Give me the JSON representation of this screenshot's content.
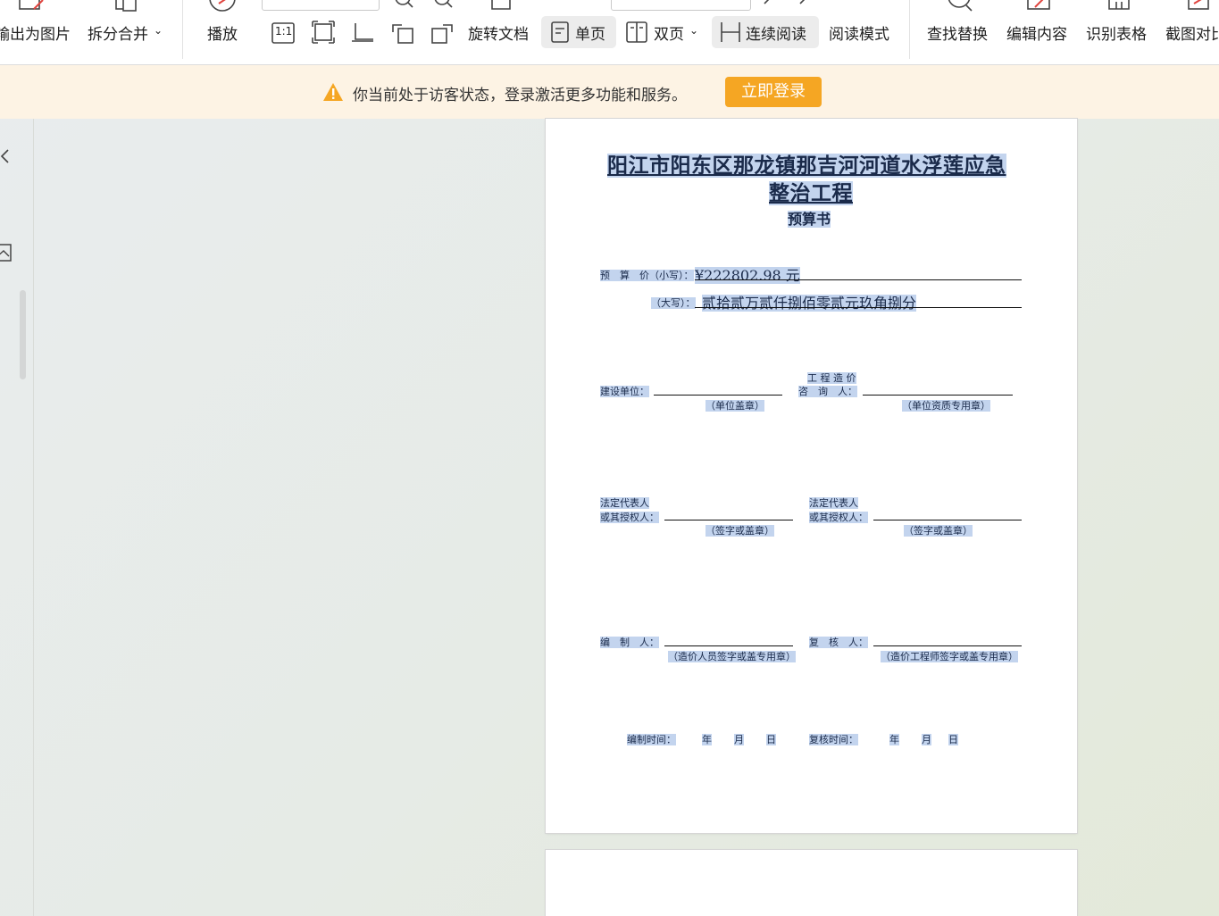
{
  "toolbar": {
    "items": [
      {
        "label": "输出为图片"
      },
      {
        "label": "拆分合并"
      },
      {
        "label": "播放"
      },
      {
        "label": "旋转文档"
      },
      {
        "label": "单页"
      },
      {
        "label": "双页"
      },
      {
        "label": "连续阅读"
      },
      {
        "label": "阅读模式"
      },
      {
        "label": "查找替换"
      },
      {
        "label": "编辑内容"
      },
      {
        "label": "识别表格"
      },
      {
        "label": "截图对比"
      }
    ],
    "ratio_label": "1:1"
  },
  "banner": {
    "message": "你当前处于访客状态，登录激活更多功能和服务。",
    "login_label": "立即登录",
    "accent": "#f5a623"
  },
  "document": {
    "title_line1": "阳江市阳东区那龙镇那吉河河道水浮莲应急",
    "title_line2": "整治工程",
    "subtitle": "预算书",
    "price_small_label": "预　算　价（小写）：",
    "price_small_value": "¥222802.98 元",
    "price_big_label": "（大写）：",
    "price_big_value": "贰拾贰万贰仟捌佰零贰元玖角捌分",
    "build_unit_label": "建设单位：",
    "build_unit_note": "（单位盖章）",
    "consult_label_top": "工 程 造 价",
    "consult_label_bottom": "咨　询　人：",
    "consult_note": "（单位资质专用章）",
    "legal_rep_line1": "法定代表人",
    "legal_rep_line2": "或其授权人：",
    "legal_rep_note": "（签字或盖章）",
    "compiler_label": "编　制　人：",
    "compiler_note": "（造价人员签字或盖专用章）",
    "reviewer_label": "复　核　人：",
    "reviewer_note": "（造价工程师签字或盖专用章）",
    "compile_time_label": "编制时间：",
    "review_time_label": "复核时间：",
    "year": "年",
    "month": "月",
    "day": "日"
  }
}
